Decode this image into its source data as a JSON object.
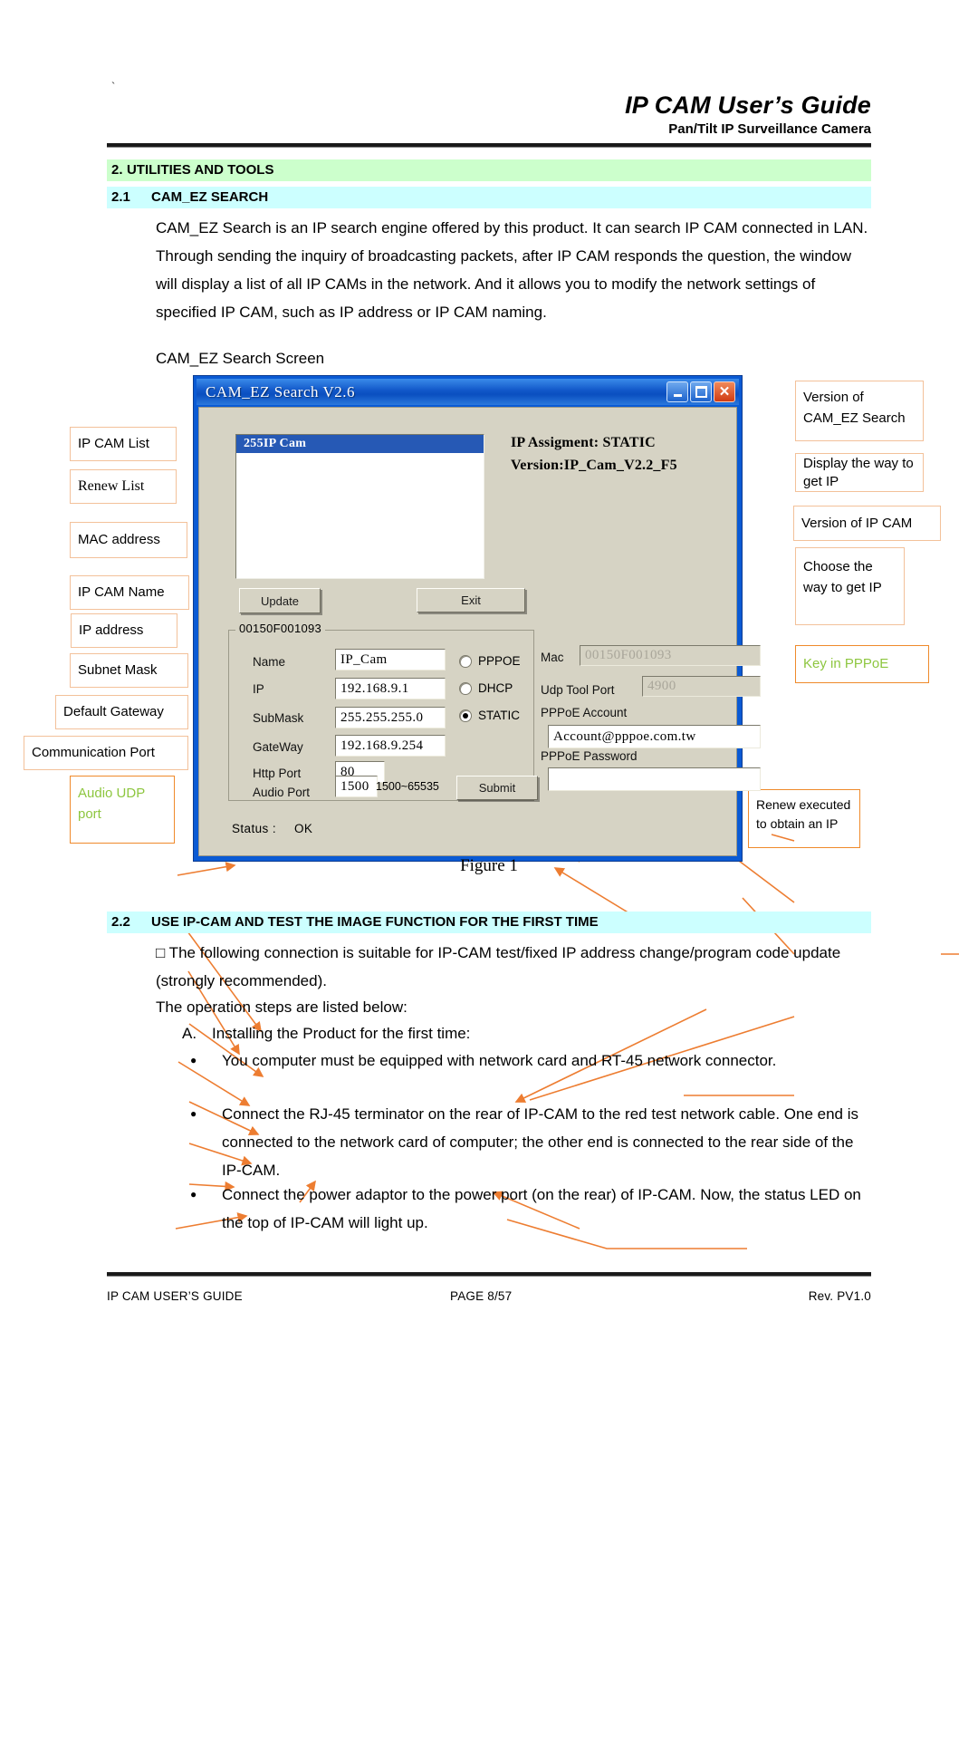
{
  "header": {
    "tick": "`",
    "title": "IP CAM User’s Guide",
    "subtitle": "Pan/Tilt IP Surveillance Camera"
  },
  "sections": {
    "s2_num": "2.",
    "s2_title": "UTILITIES AND TOOLS",
    "s21_num": "2.1",
    "s21_title_a": "CAM_EZ ",
    "s21_title_b": "SEARCH",
    "s22_num": "2.2",
    "s22_title_a": "USE IP-CAM ",
    "s22_title_b": "AND TEST THE IMAGE FUNCTION FOR THE FIRST TIME"
  },
  "body": {
    "intro": "CAM_EZ Search is an IP search engine offered by this product. It can search IP CAM connected in LAN. Through sending the inquiry of broadcasting packets, after IP CAM responds the question, the window will display a list of all IP CAMs in the network. And it allows you to modify the network settings of specified IP CAM, such as IP address or IP CAM naming.",
    "screen_line": "CAM_EZ Search Screen",
    "figure_caption": "Figure 1",
    "p22a": "□ The following connection is suitable for IP-CAM test/fixed IP address change/program code update (strongly recommended).",
    "p22b": "The operation steps are listed below:",
    "p22c": "A. Installing the Product for the first time:",
    "bullets": [
      "You computer must be equipped with network card and RT-45 network connector.",
      "Connect the RJ-45 terminator on the rear of IP-CAM to the red test network cable. One end is connected to the network card of computer; the other end is connected to the rear side of the IP-CAM.",
      "Connect the power adaptor to the power port (on the rear) of IP-CAM. Now, the status LED on the top of IP-CAM will light up."
    ]
  },
  "dialog": {
    "title": "CAM_EZ Search V2.6",
    "window_buttons": [
      "minimize-icon",
      "maximize-icon",
      "close-icon"
    ],
    "list_items": [
      "255IP Cam"
    ],
    "ip_assignment": "IP Assigment: STATIC",
    "version": "Version:IP_Cam_V2.2_F5",
    "btn_update": "Update",
    "btn_exit": "Exit",
    "btn_submit": "Submit",
    "group_legend": "00150F001093",
    "fields": {
      "name_label": "Name",
      "name_value": "IP_Cam",
      "ip_label": "IP",
      "ip_value": "192.168.9.1",
      "submask_label": "SubMask",
      "submask_value": "255.255.255.0",
      "gateway_label": "GateWay",
      "gateway_value": "192.168.9.254",
      "http_label": "Http Port",
      "http_value": "80",
      "audio_label": "Audio Port",
      "audio_value": "1500",
      "audio_range": "1500~65535",
      "mac_label": "Mac",
      "mac_value": "00150F001093",
      "udp_label": "Udp Tool Port",
      "udp_value": "4900",
      "pppoe_account_label": "PPPoE Account",
      "pppoe_account_value": "Account@pppoe.com.tw",
      "pppoe_password_label": "PPPoE Password",
      "pppoe_password_value": ""
    },
    "radios": [
      {
        "label": "PPPOE",
        "selected": false
      },
      {
        "label": "DHCP",
        "selected": false
      },
      {
        "label": "STATIC",
        "selected": true
      }
    ],
    "status_label": "Status :",
    "status_value": "OK"
  },
  "callouts_left": [
    {
      "text": "IP CAM List"
    },
    {
      "text": "Renew List"
    },
    {
      "text": "MAC address"
    },
    {
      "text": "IP CAM Name"
    },
    {
      "text": "IP address"
    },
    {
      "text": "Subnet Mask"
    },
    {
      "text": "Default Gateway"
    },
    {
      "text": "Communication Port"
    },
    {
      "text": "Audio UDP port"
    }
  ],
  "callouts_right": [
    {
      "text": "Version of CAM_EZ Search"
    },
    {
      "text": "Display the way to get IP"
    },
    {
      "text": "Version of IP CAM"
    },
    {
      "text": "Choose the way to get IP"
    },
    {
      "text": "Key in PPPoE"
    },
    {
      "text": "Renew executed to obtain an IP"
    }
  ],
  "footer": {
    "left": "IP CAM USER’S GUIDE",
    "middle": "PAGE 8/57",
    "right": "Rev. PV1.0"
  },
  "colors": {
    "band_green": "#ccffcc",
    "band_cyan": "#ccffff",
    "callout_border": "#f3c19a",
    "callout_border_strong": "#ef8a2b",
    "highlight_green_text": "#8dc63f",
    "connector_orange": "#ed7d31",
    "titlebar_blue": "#0a5ad4",
    "dialog_face": "#d6d3c4"
  }
}
